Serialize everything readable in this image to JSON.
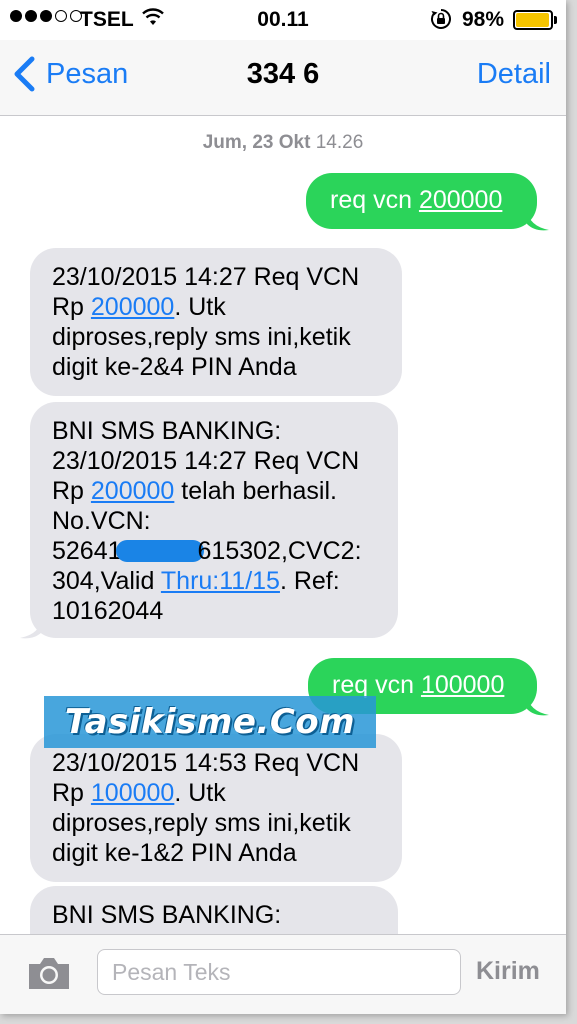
{
  "status_bar": {
    "carrier": "TSEL",
    "time": "00.11",
    "battery_percent": "98%",
    "battery_level": 0.98,
    "signal_bars_filled": 3,
    "signal_bars_total": 5,
    "battery_color": "#f5c400"
  },
  "nav": {
    "back_label": "Pesan",
    "title": "334 6",
    "detail_label": "Detail",
    "accent_color": "#1a7cf5"
  },
  "conversation": {
    "timestamp_day": "Jum, 23 Okt",
    "timestamp_time": "14.26",
    "messages": [
      {
        "direction": "out",
        "text": "req vcn ",
        "link": "200000"
      },
      {
        "direction": "in",
        "line1": "23/10/2015 14:27 Req VCN",
        "line2_pre": "Rp ",
        "line2_link": "200000",
        "line2_post": ". Utk",
        "line3": "diproses,reply sms ini,ketik",
        "line4": "digit ke-2&4 PIN Anda"
      },
      {
        "direction": "in",
        "line1": "BNI SMS BANKING:",
        "line2": "23/10/2015 14:27 Req VCN",
        "line3_pre": "Rp ",
        "line3_link": "200000",
        "line3_post": " telah berhasil.",
        "line4": "No.VCN:",
        "line5_pre": "52641",
        "line5_post": "615302,CVC2:",
        "line6_pre": "304,Valid ",
        "line6_link": "Thru:11/15",
        "line6_post": ". Ref:",
        "line7": "10162044"
      },
      {
        "direction": "out",
        "text": "req vcn ",
        "link": "100000"
      },
      {
        "direction": "in",
        "line1": "23/10/2015 14:53 Req VCN",
        "line2_pre": "Rp ",
        "line2_link": "100000",
        "line2_post": ". Utk",
        "line3": "diproses,reply sms ini,ketik",
        "line4": "digit ke-1&2 PIN Anda"
      },
      {
        "direction": "in",
        "line1": "BNI SMS BANKING:"
      }
    ],
    "outgoing_color": "#2bd45a",
    "incoming_color": "#e5e5ea"
  },
  "watermark": {
    "text": "Tasikisme.Com"
  },
  "input_bar": {
    "camera_icon": "camera-icon",
    "placeholder": "Pesan Teks",
    "send_label": "Kirim"
  }
}
